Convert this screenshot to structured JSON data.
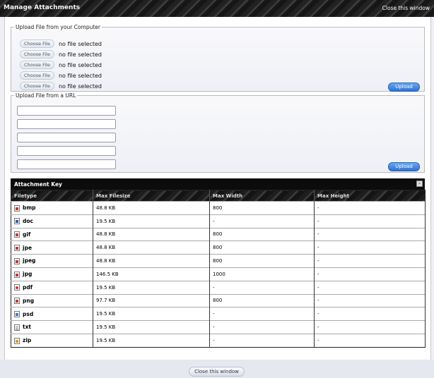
{
  "window": {
    "title": "Manage Attachments",
    "close_link": "Close this window"
  },
  "upload_computer": {
    "legend": "Upload File from your Computer",
    "choose_label": "Choose File",
    "status": "no file selected",
    "upload_label": "Upload"
  },
  "upload_url": {
    "legend": "Upload File from a URL",
    "upload_label": "Upload"
  },
  "key": {
    "title": "Attachment Key",
    "toggle": "-",
    "columns": [
      "Filetype",
      "Max Filesize",
      "Max Width",
      "Max Height"
    ],
    "rows": [
      {
        "type": "bmp",
        "icon": "image-file-icon",
        "size": "48.8 KB",
        "width": "800",
        "height": "-"
      },
      {
        "type": "doc",
        "icon": "word-doc-icon",
        "size": "19.5 KB",
        "width": "-",
        "height": "-"
      },
      {
        "type": "gif",
        "icon": "image-file-icon",
        "size": "48.8 KB",
        "width": "800",
        "height": "-"
      },
      {
        "type": "jpe",
        "icon": "image-file-icon",
        "size": "48.8 KB",
        "width": "800",
        "height": "-"
      },
      {
        "type": "jpeg",
        "icon": "image-file-icon",
        "size": "48.8 KB",
        "width": "800",
        "height": "-"
      },
      {
        "type": "jpg",
        "icon": "image-file-icon",
        "size": "146.5 KB",
        "width": "1000",
        "height": "-"
      },
      {
        "type": "pdf",
        "icon": "pdf-file-icon",
        "size": "19.5 KB",
        "width": "-",
        "height": "-"
      },
      {
        "type": "png",
        "icon": "image-file-icon",
        "size": "97.7 KB",
        "width": "800",
        "height": "-"
      },
      {
        "type": "psd",
        "icon": "psd-file-icon",
        "size": "19.5 KB",
        "width": "-",
        "height": "-"
      },
      {
        "type": "txt",
        "icon": "text-file-icon",
        "size": "19.5 KB",
        "width": "-",
        "height": "-"
      },
      {
        "type": "zip",
        "icon": "zip-file-icon",
        "size": "19.5 KB",
        "width": "-",
        "height": "-"
      }
    ]
  },
  "footer": {
    "close_button": "Close this window"
  }
}
